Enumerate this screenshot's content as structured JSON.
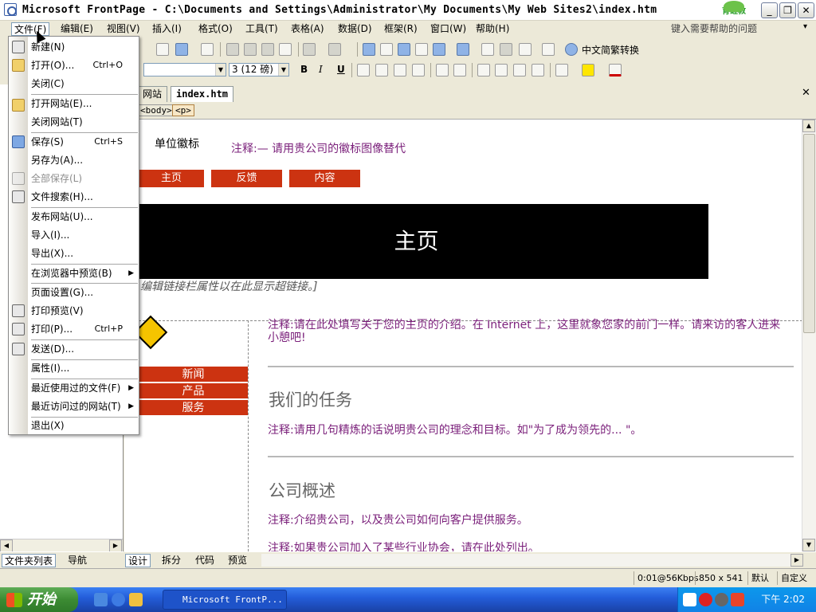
{
  "window": {
    "title": "Microsoft FrontPage - C:\\Documents and Settings\\Administrator\\My Documents\\My Web Sites2\\index.htm",
    "logo_text": "育鲤教",
    "min": "_",
    "max": "❐",
    "close": "✕"
  },
  "menubar": {
    "items": [
      "文件(F)",
      "编辑(E)",
      "视图(V)",
      "插入(I)",
      "格式(O)",
      "工具(T)",
      "表格(A)",
      "数据(D)",
      "框架(R)",
      "窗口(W)",
      "帮助(H)"
    ],
    "help_placeholder": "键入需要帮助的问题"
  },
  "toolbar": {
    "convert_label": "中文简繁转换",
    "font_size": "3 (12 磅)",
    "bold": "B",
    "italic": "I",
    "underline": "U"
  },
  "file_menu": {
    "items": [
      {
        "label": "新建(N)",
        "shortcut": "",
        "sub": ""
      },
      {
        "label": "打开(O)...",
        "shortcut": "Ctrl+O",
        "sub": ""
      },
      {
        "label": "关闭(C)",
        "shortcut": "",
        "sub": ""
      },
      {
        "label": "打开网站(E)...",
        "shortcut": "",
        "sub": ""
      },
      {
        "label": "关闭网站(T)",
        "shortcut": "",
        "sub": ""
      },
      {
        "label": "保存(S)",
        "shortcut": "Ctrl+S",
        "sub": ""
      },
      {
        "label": "另存为(A)...",
        "shortcut": "",
        "sub": ""
      },
      {
        "label": "全部保存(L)",
        "shortcut": "",
        "sub": ""
      },
      {
        "label": "文件搜索(H)...",
        "shortcut": "",
        "sub": ""
      },
      {
        "label": "发布网站(U)...",
        "shortcut": "",
        "sub": ""
      },
      {
        "label": "导入(I)...",
        "shortcut": "",
        "sub": ""
      },
      {
        "label": "导出(X)...",
        "shortcut": "",
        "sub": ""
      },
      {
        "label": "在浏览器中预览(B)",
        "shortcut": "",
        "sub": "▶"
      },
      {
        "label": "页面设置(G)...",
        "shortcut": "",
        "sub": ""
      },
      {
        "label": "打印预览(V)",
        "shortcut": "",
        "sub": ""
      },
      {
        "label": "打印(P)...",
        "shortcut": "Ctrl+P",
        "sub": ""
      },
      {
        "label": "发送(D)...",
        "shortcut": "",
        "sub": ""
      },
      {
        "label": "属性(I)...",
        "shortcut": "",
        "sub": ""
      },
      {
        "label": "最近使用过的文件(F)",
        "shortcut": "",
        "sub": "▶"
      },
      {
        "label": "最近访问过的网站(T)",
        "shortcut": "",
        "sub": "▶"
      },
      {
        "label": "退出(X)",
        "shortcut": "",
        "sub": ""
      }
    ]
  },
  "doc_tabs": {
    "site": "网站",
    "file": "index.htm",
    "close": "✕"
  },
  "quick_tags": [
    "<body>",
    "<p>"
  ],
  "page": {
    "logo_label": "单位徽标",
    "logo_note": "注释:— 请用贵公司的徽标图像替代",
    "nav": [
      "主页",
      "反馈",
      "内容"
    ],
    "banner": "主页",
    "nav_hint": "编辑链接栏属性以在此显示超链接。]",
    "side_nav": [
      "新闻",
      "产品",
      "服务"
    ],
    "intro_note": "注释:请在此处填写关于您的主页的介绍。在 Internet 上，这里就象您家的前门一样。请来访的客人进来小憩吧!",
    "mission_title": "我们的任务",
    "mission_note": "注释:请用几句精炼的话说明贵公司的理念和目标。如\"为了成为领先的... \"。",
    "overview_title": "公司概述",
    "overview_note": "注释:介绍贵公司，以及贵公司如何向客户提供服务。",
    "assoc_note": "注释:如果贵公司加入了某些行业协会，请在此处列出。"
  },
  "left_tabs": [
    "文件夹列表",
    "导航"
  ],
  "view_tabs": [
    "设计",
    "拆分",
    "代码",
    "预览"
  ],
  "status": {
    "load": "0:01@56Kbps",
    "size": "850 x 541",
    "mode": "默认",
    "custom": "自定义"
  },
  "taskbar": {
    "start": "开始",
    "task": "Microsoft FrontP...",
    "clock": "下午 2:02"
  }
}
